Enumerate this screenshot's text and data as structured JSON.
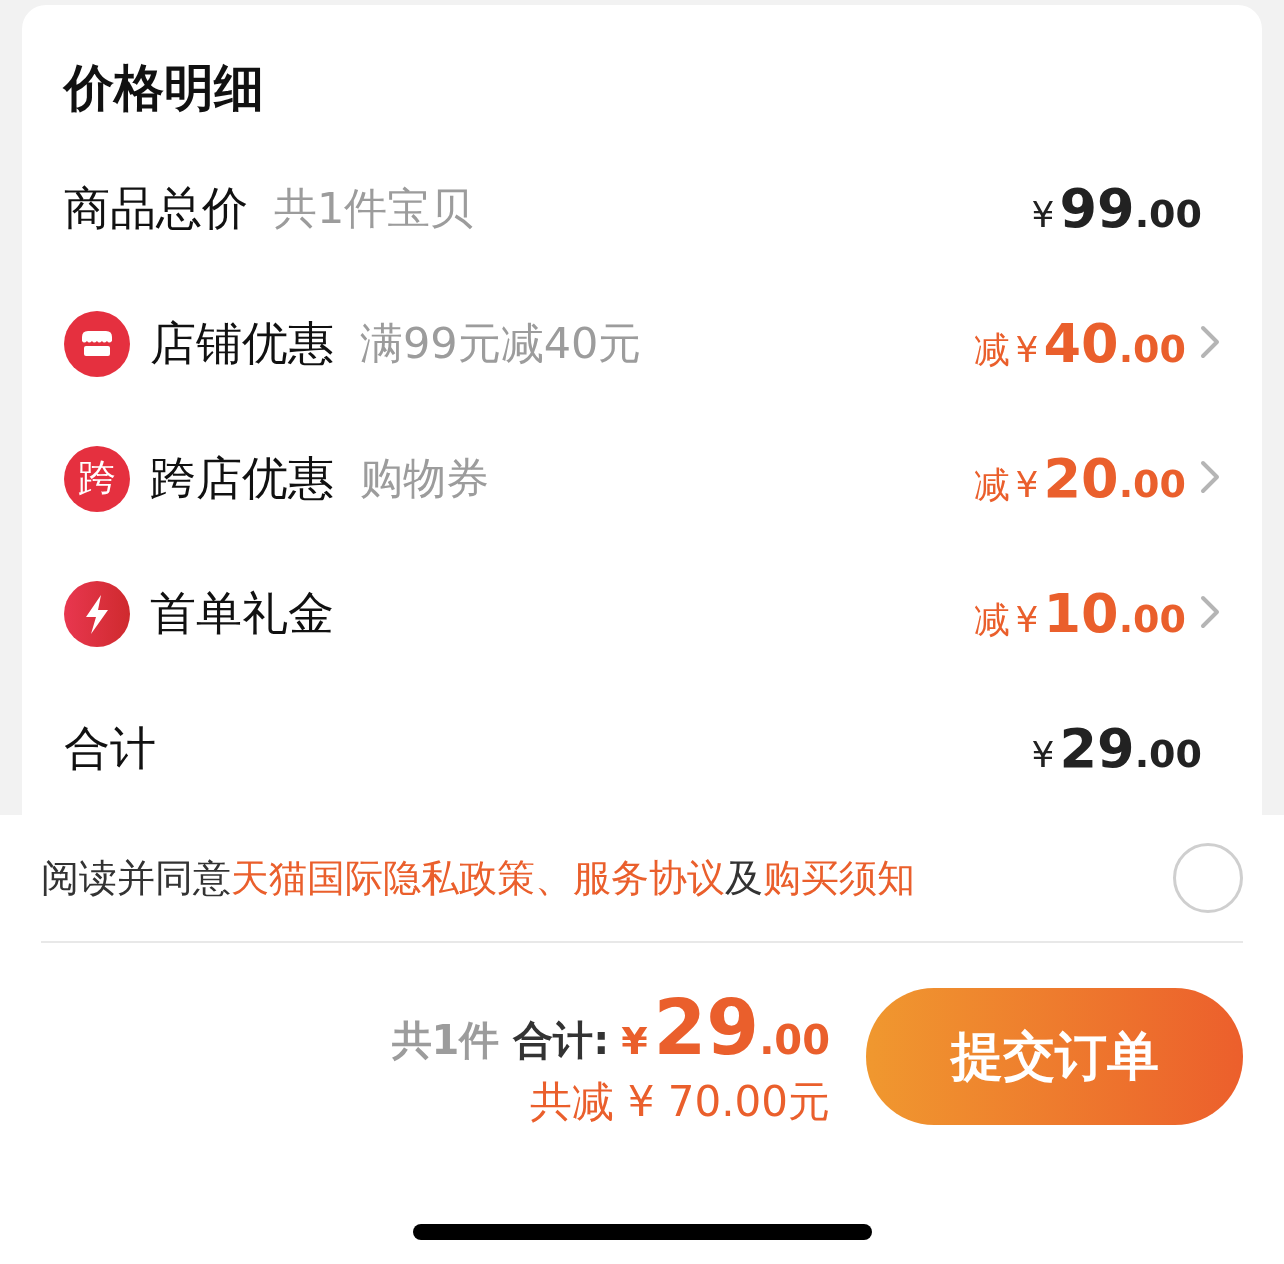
{
  "title": "价格明细",
  "rows": [
    {
      "kind": "total",
      "label": "商品总价",
      "note": "共1件宝贝",
      "currency": "¥",
      "amount": "99",
      "decimal": ".00"
    },
    {
      "kind": "discount",
      "label": "店铺优惠",
      "note": "满99元减40元",
      "prefix": "减",
      "currency": "¥",
      "amount": "40",
      "decimal": ".00"
    },
    {
      "kind": "discount",
      "icon_text": "跨",
      "label": "跨店优惠",
      "note": "购物券",
      "prefix": "减",
      "currency": "¥",
      "amount": "20",
      "decimal": ".00"
    },
    {
      "kind": "discount",
      "label": "首单礼金",
      "prefix": "减",
      "currency": "¥",
      "amount": "10",
      "decimal": ".00"
    },
    {
      "kind": "total",
      "label": "合计",
      "currency": "¥",
      "amount": "29",
      "decimal": ".00"
    }
  ],
  "agreement": {
    "checked": false,
    "parts": [
      {
        "kind": "plain",
        "text": "阅读并同意"
      },
      {
        "kind": "link",
        "text": "天猫国际隐私政策"
      },
      {
        "kind": "link",
        "text": "、服务协议"
      },
      {
        "kind": "plain",
        "text": "及"
      },
      {
        "kind": "link",
        "text": "购买须知"
      }
    ]
  },
  "footer": {
    "count": "共1件",
    "label": "合计:",
    "currency": "¥",
    "amount": "29",
    "decimal": ".00",
    "saving": "共减 ¥ 70.00元",
    "button": "提交订单"
  }
}
